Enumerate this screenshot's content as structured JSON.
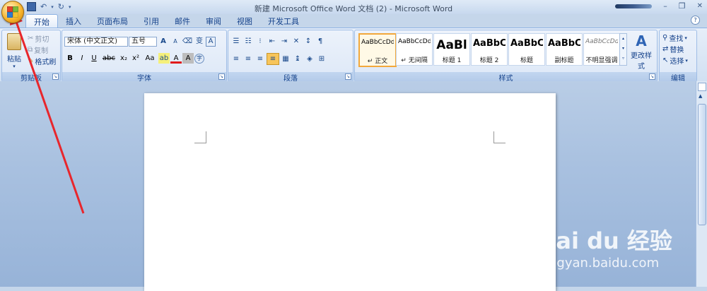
{
  "window": {
    "title": "新建 Microsoft Office Word 文档 (2) - Microsoft Word"
  },
  "ribbon_tabs": [
    {
      "label": "开始",
      "active": true
    },
    {
      "label": "插入"
    },
    {
      "label": "页面布局"
    },
    {
      "label": "引用"
    },
    {
      "label": "邮件"
    },
    {
      "label": "审阅"
    },
    {
      "label": "视图"
    },
    {
      "label": "开发工具"
    }
  ],
  "clipboard": {
    "paste_label": "粘贴",
    "cut_label": "剪切",
    "copy_label": "复制",
    "format_painter_label": "格式刷",
    "group_label": "剪贴板"
  },
  "font": {
    "font_name": "宋体 (中文正文)",
    "font_size": "五号",
    "group_label": "字体",
    "size_up": "A",
    "size_down": "A",
    "phonetic": "变",
    "bold": "B",
    "italic": "I",
    "underline": "U",
    "strike": "abc",
    "subscript": "x₂",
    "superscript": "x²",
    "change_case": "Aa",
    "font_color": "A",
    "char_shading": "A",
    "enclose": "字"
  },
  "paragraph": {
    "group_label": "段落"
  },
  "styles": {
    "group_label": "样式",
    "items": [
      {
        "sample": "AaBbCcDd",
        "name": "↵ 正文",
        "selected": true
      },
      {
        "sample": "AaBbCcDd",
        "name": "↵ 无间隔"
      },
      {
        "sample": "AaBl",
        "name": "标题 1"
      },
      {
        "sample": "AaBbC",
        "name": "标题 2"
      },
      {
        "sample": "AaBbC",
        "name": "标题"
      },
      {
        "sample": "AaBbC",
        "name": "副标题"
      },
      {
        "sample": "AaBbCcDd",
        "name": "不明显强调"
      }
    ],
    "change_styles_label": "更改样式"
  },
  "editing": {
    "find_label": "查找",
    "replace_label": "替换",
    "select_label": "选择",
    "group_label": "编辑"
  },
  "watermark": {
    "brand": "Bai du 经验",
    "url": "jingyan.baidu.com"
  },
  "colors": {
    "arrow": "#e8262c",
    "ribbon_text": "#15428b",
    "accent": "#f2a83b"
  }
}
